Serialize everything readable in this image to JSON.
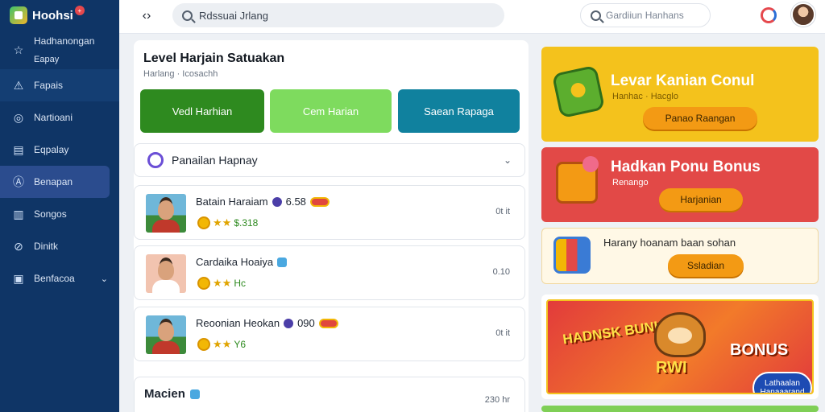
{
  "app": {
    "name": "Hoohsi",
    "badge": "+"
  },
  "sidebar": {
    "items": [
      {
        "label": "Hadhanongan",
        "sub": "Eapay",
        "icon": "star-icon"
      },
      {
        "label": "Fapais",
        "icon": "alert-icon"
      },
      {
        "label": "Nartioani",
        "icon": "globe-icon"
      },
      {
        "label": "Eqpalay",
        "icon": "document-icon"
      },
      {
        "label": "Benapan",
        "icon": "user-circle-icon"
      },
      {
        "label": "Songos",
        "icon": "chart-icon"
      },
      {
        "label": "Dinitk",
        "icon": "link-icon"
      },
      {
        "label": "Benfacoa",
        "icon": "box-icon"
      }
    ]
  },
  "topbar": {
    "search_value": "Rdssuai Jrlang",
    "search2_placeholder": "Gardiiun Hanhans"
  },
  "main": {
    "title": "Level Harjain Satuakan",
    "subtitle": "Harlang · Icosachh",
    "tabs": [
      {
        "label": "Vedl Harhian",
        "color": "#2e8a1f"
      },
      {
        "label": "Cem Harian",
        "color": "#7edb5e"
      },
      {
        "label": "Saean Rapaga",
        "color": "#10819e"
      }
    ],
    "dropdown_label": "Panailan Hapnay",
    "cards": [
      {
        "name": "Batain Haraiam",
        "score": "6.58",
        "stars": "★★",
        "value": "$.318",
        "right": "0t it"
      },
      {
        "name": "Cardaika Hoaiya",
        "score": "",
        "stars": "★★",
        "value": "Hc",
        "right": "0.10"
      },
      {
        "name": "Reoonian Heokan",
        "score": "090",
        "stars": "★★",
        "value": "Y6",
        "right": "0t it"
      }
    ],
    "last_card": {
      "name": "Macien",
      "right": "230 hr"
    }
  },
  "promos": {
    "p1": {
      "title": "Levar Kanian Conul",
      "sub": "Hanhac · Hacglo",
      "button": "Panao Raangan"
    },
    "p2": {
      "title": "Hadkan Ponu Bonus",
      "sub": "Renango",
      "button": "Harjanian"
    },
    "p3": {
      "title": "Harany hoanam baan sohan",
      "button": "Ssladian"
    },
    "banner": {
      "t1": "HADNSK BUNKSS",
      "t2": "RWI",
      "t3": "BONUS",
      "floater": "Lathaalan Hanaaarand"
    }
  }
}
